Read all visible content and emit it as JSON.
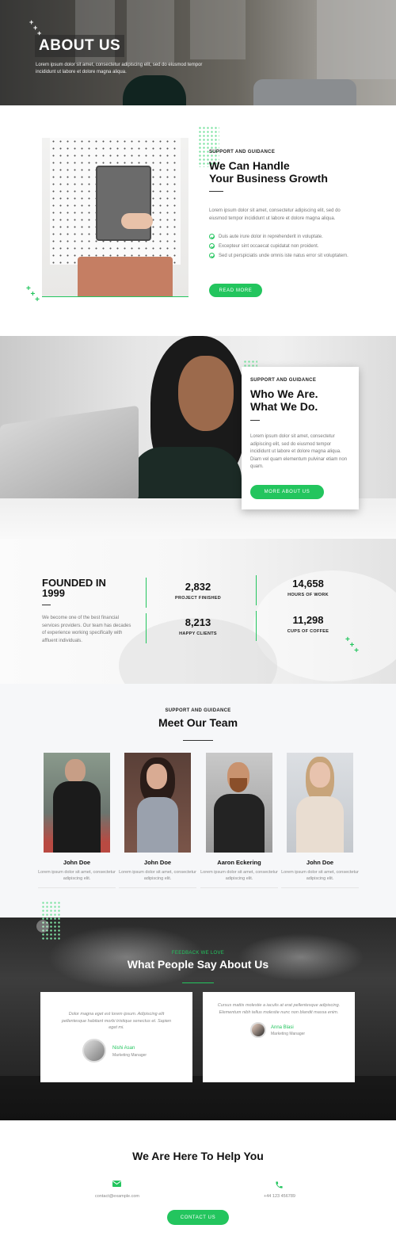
{
  "colors": {
    "accent": "#23c55e",
    "dark_text": "#111111"
  },
  "hero": {
    "title": "ABOUT US",
    "subtitle": "Lorem ipsum dolor sit amet, consectetur adipiscing elit, sed do eiusmod tempor incididunt ut labore et dolore magna aliqua."
  },
  "growth": {
    "eyebrow": "SUPPORT AND GUIDANCE",
    "title_line1": "We Can Handle",
    "title_line2": "Your Business Growth",
    "paragraph": "Lorem ipsum dolor sit amet, consectetur adipiscing elit, sed do eiusmod tempor incididunt ut labore et dolore magna aliqua.",
    "checks": [
      "Duis aute irure dolor in reprehenderit in voluptate.",
      "Excepteur sint occaecat cupidatat non proident.",
      "Sed ut perspiciatis unde omnis iste natus error sit voluptatem."
    ],
    "button": "READ MORE"
  },
  "who": {
    "eyebrow": "SUPPORT AND GUIDANCE",
    "title_line1": "Who We Are.",
    "title_line2": "What We Do.",
    "paragraph": "Lorem ipsum dolor sit amet, consectetur adipiscing elit, sed do eiusmod tempor incididunt ut labore et dolore magna aliqua. Diam vel quam elementum pulvinar etiam non quam.",
    "button": "MORE ABOUT US"
  },
  "stats": {
    "founded_line1": "FOUNDED IN",
    "founded_line2": "1999",
    "paragraph": "We become one of the best financial services providers. Our team has decades of experience working specifically with affluent individuals.",
    "items": [
      {
        "number": "2,832",
        "label": "PROJECT FINISHED"
      },
      {
        "number": "14,658",
        "label": "HOURS OF WORK"
      },
      {
        "number": "8,213",
        "label": "HAPPY CLIENTS"
      },
      {
        "number": "11,298",
        "label": "CUPS OF COFFEE"
      }
    ]
  },
  "team": {
    "eyebrow": "SUPPORT AND GUIDANCE",
    "title": "Meet Our Team",
    "members": [
      {
        "name": "John Doe",
        "desc": "Lorem ipsum dolor sit amet, consectetur adipiscing elit."
      },
      {
        "name": "John Doe",
        "desc": "Lorem ipsum dolor sit amet, consectetur adipiscing elit."
      },
      {
        "name": "Aaron Eckering",
        "desc": "Lorem ipsum dolor sit amet, consectetur adipiscing elit."
      },
      {
        "name": "John Doe",
        "desc": "Lorem ipsum dolor sit amet, consectetur adipiscing elit."
      }
    ]
  },
  "testimonials": {
    "eyebrow": "FEEDBACK WE LOVE",
    "title": "What People Say About Us",
    "items": [
      {
        "quote": "Dolor magna eget est lorem ipsum. Adipiscing elit pellentesque habitant morbi tristique senectus et. Sapien eget mi.",
        "name": "Nishi Asan",
        "role": "Marketing Manager"
      },
      {
        "quote": "Cursus mattis molestie a iaculis at erat pellentesque adipiscing. Elementum nibh tellus molestie nunc non blandit massa enim.",
        "name": "Anna Blasi",
        "role": "Marketing Manager"
      }
    ]
  },
  "contact": {
    "title": "We Are Here To Help You",
    "email": "contact@example.com",
    "phone": "+44 123 456789",
    "button": "CONTACT US",
    "email_icon": "envelope-icon",
    "phone_icon": "phone-icon"
  }
}
